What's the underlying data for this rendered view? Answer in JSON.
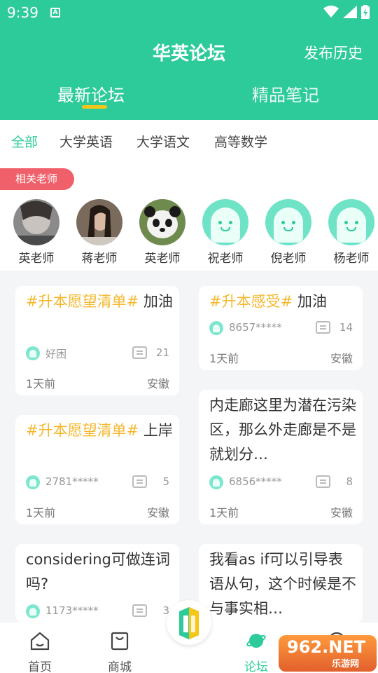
{
  "status": {
    "time": "9:39",
    "notification": "A"
  },
  "header": {
    "title": "华英论坛",
    "action": "发布历史"
  },
  "tabs": {
    "latest": "最新论坛",
    "notes": "精品笔记"
  },
  "filters": [
    "全部",
    "大学英语",
    "大学语文",
    "高等数学"
  ],
  "teachers": {
    "badge": "相关老师",
    "list": [
      {
        "name": "英老师"
      },
      {
        "name": "蒋老师"
      },
      {
        "name": "英老师"
      },
      {
        "name": "祝老师"
      },
      {
        "name": "倪老师"
      },
      {
        "name": "杨老师"
      }
    ]
  },
  "posts": [
    {
      "tag": "#升本愿望清单#",
      "text": " 加油",
      "user": "好困",
      "comments": "21",
      "time": "1天前",
      "location": "安徽"
    },
    {
      "tag": "#升本感受#",
      "text": " 加油",
      "user": "8657*****",
      "comments": "14",
      "time": "1天前",
      "location": "安徽"
    },
    {
      "tag": "#升本愿望清单#",
      "text": " 上岸",
      "user": "2781*****",
      "comments": "5",
      "time": "1天前",
      "location": "安徽"
    },
    {
      "tag": "",
      "text": "内走廊这里为潜在污染区，那么外走廊是不是就划分…",
      "user": "6856*****",
      "comments": "8",
      "time": "1天前",
      "location": "安徽"
    },
    {
      "tag": "",
      "text": "considering可做连词吗?",
      "user": "1173*****",
      "comments": "3"
    },
    {
      "tag": "",
      "text": "我看as if可以引导表语从句，这个时候是不与事实相…"
    }
  ],
  "nav": {
    "home": "首页",
    "mall": "商城",
    "forum": "论坛"
  },
  "watermark": {
    "number": "962.NET",
    "text": "乐游网"
  },
  "colors": {
    "primary": "#2ecb9a",
    "tag": "#f5b82e",
    "badge": "#f0606a",
    "underline": "#f5c518"
  }
}
